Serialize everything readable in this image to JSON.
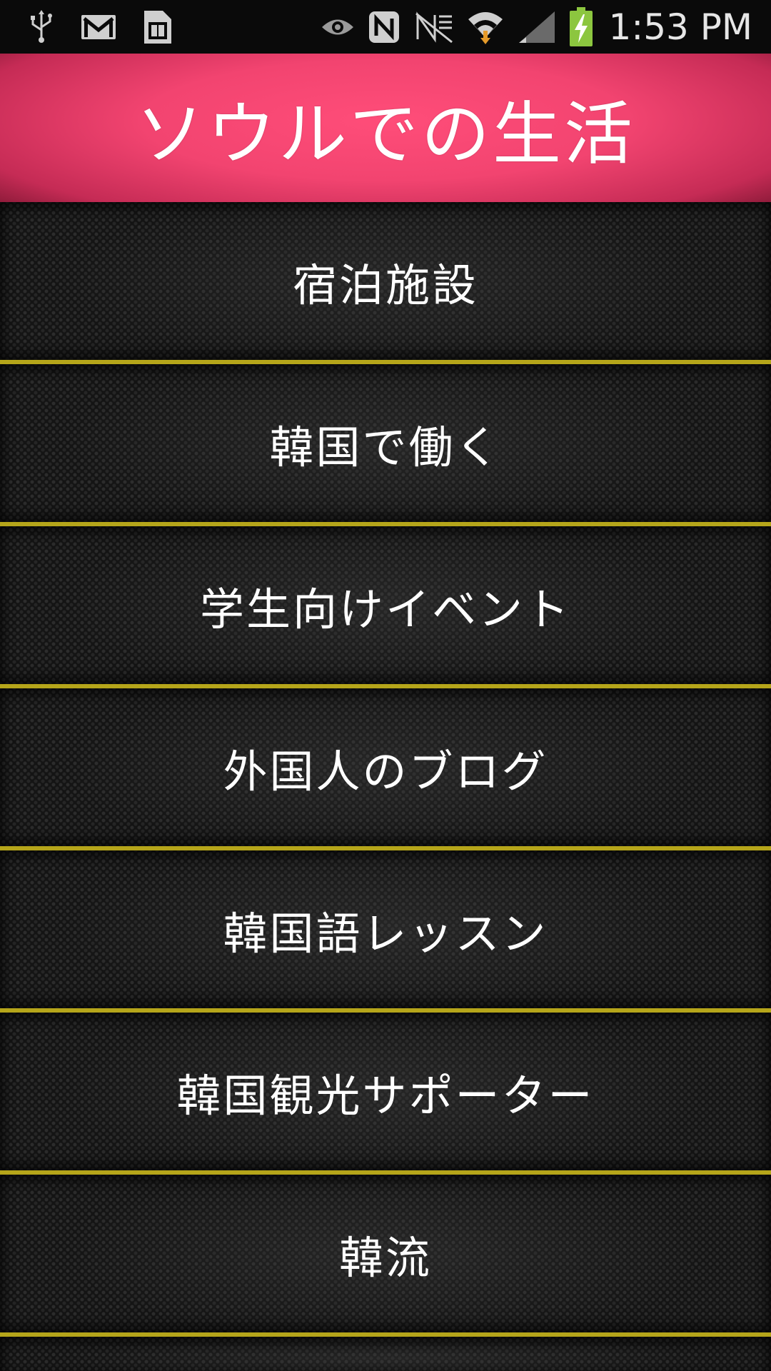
{
  "status_bar": {
    "time": "1:53 PM",
    "icons_left": [
      "usb-icon",
      "gmail-icon",
      "sim-card-icon"
    ],
    "icons_right": [
      "eye-icon",
      "nfc-icon",
      "no-signal-icon",
      "wifi-icon",
      "cell-signal-icon",
      "battery-charging-icon"
    ]
  },
  "header": {
    "title": "ソウルでの生活"
  },
  "menu": {
    "items": [
      {
        "label": "宿泊施設"
      },
      {
        "label": "韓国で働く"
      },
      {
        "label": "学生向けイベント"
      },
      {
        "label": "外国人のブログ"
      },
      {
        "label": "韓国語レッスン"
      },
      {
        "label": "韓国観光サポーター"
      },
      {
        "label": "韓流"
      }
    ]
  },
  "colors": {
    "header_pink": "#f24470",
    "divider_yellow": "#b5a51a",
    "background": "#141414",
    "text": "#ffffff"
  }
}
